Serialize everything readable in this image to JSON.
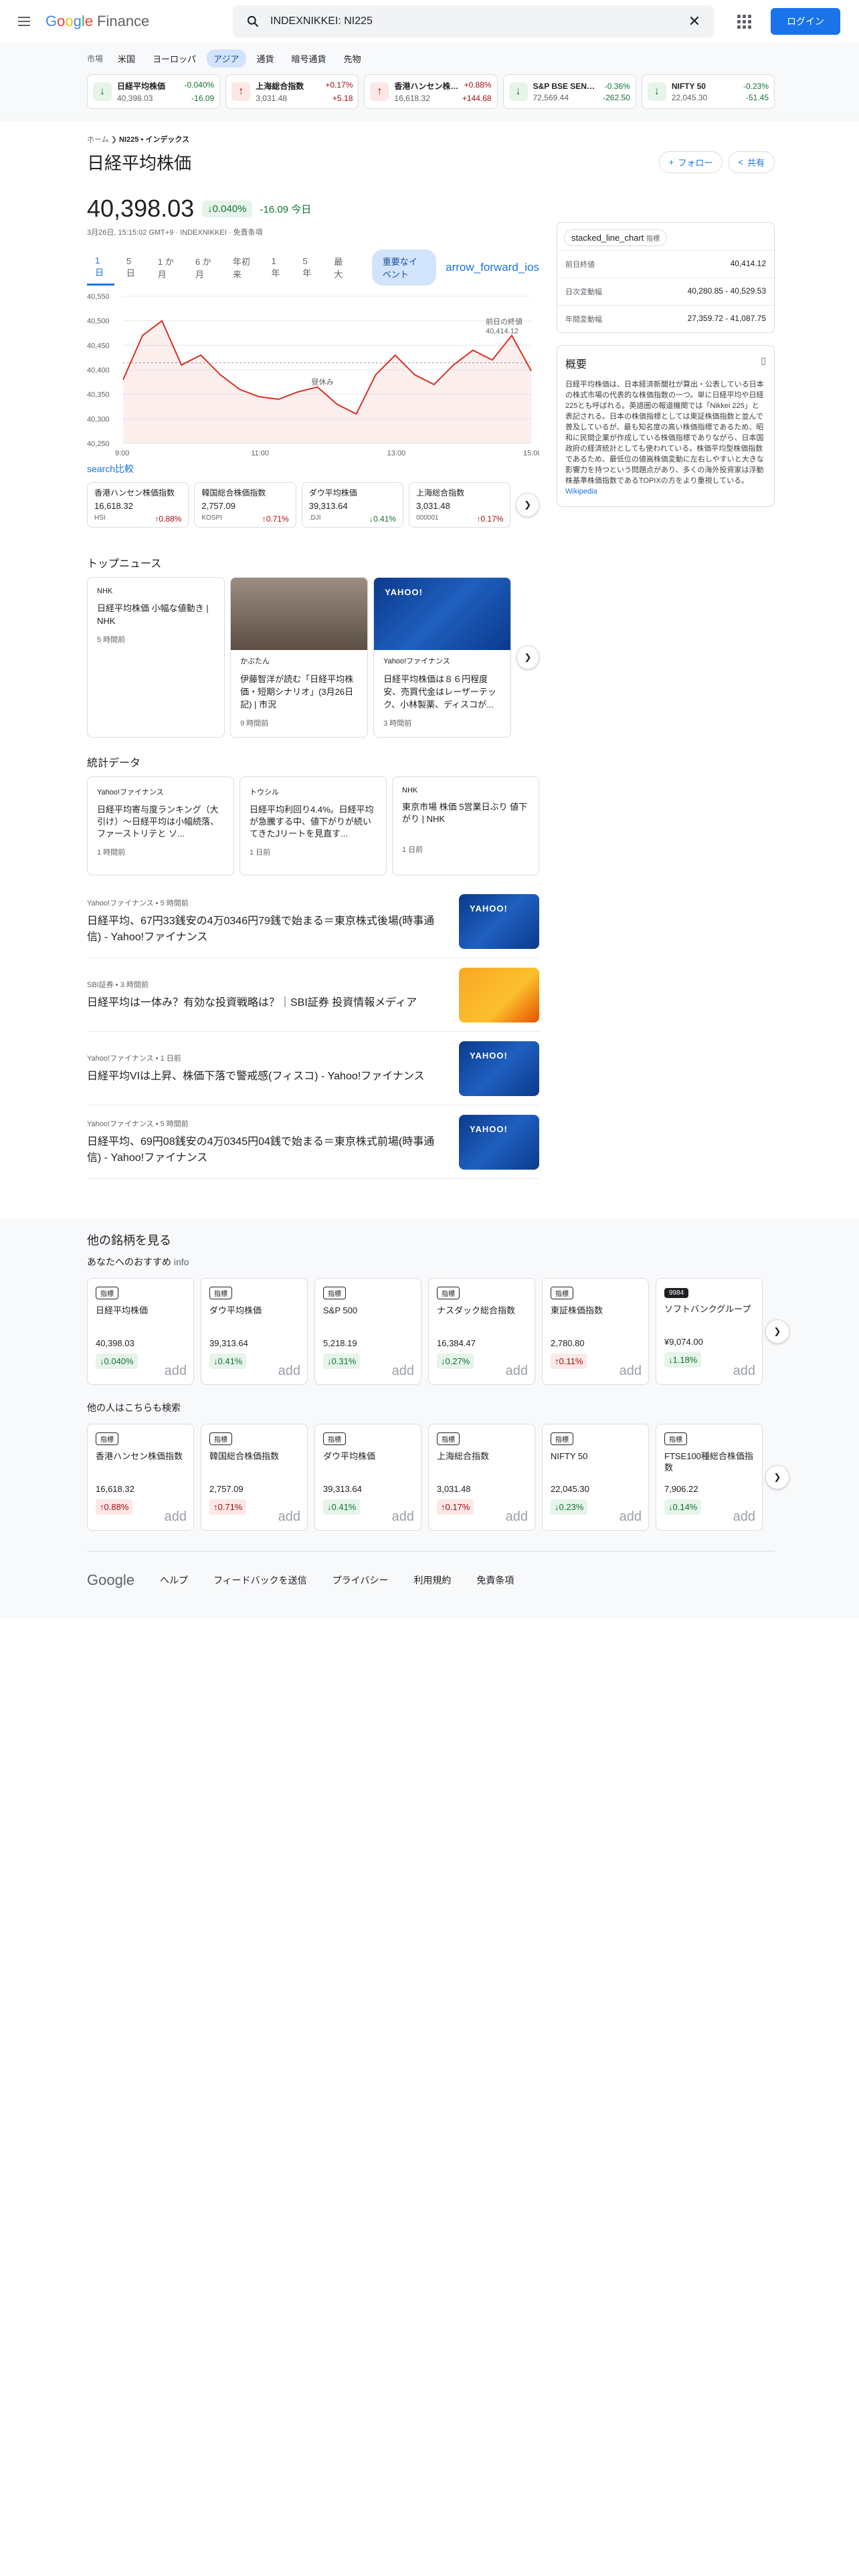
{
  "header": {
    "logo_google": [
      "G",
      "o",
      "o",
      "g",
      "l",
      "e"
    ],
    "logo_finance": "Finance",
    "search_value": "INDEXNIKKEI: NI225",
    "login_label": "ログイン"
  },
  "markets": {
    "label": "市場",
    "tabs": [
      "米国",
      "ヨーロッパ",
      "アジア",
      "通貨",
      "暗号通貨",
      "先物"
    ],
    "active_tab": "アジア",
    "tickers": [
      {
        "name": "日経平均株価",
        "pct": "-0.040%",
        "price": "40,398.03",
        "chg": "-16.09",
        "dir": "down"
      },
      {
        "name": "上海総合指数",
        "pct": "+0.17%",
        "price": "3,031.48",
        "chg": "+5.18",
        "dir": "up"
      },
      {
        "name": "香港ハンセン株価...",
        "pct": "+0.88%",
        "price": "16,618.32",
        "chg": "+144.68",
        "dir": "up"
      },
      {
        "name": "S&P BSE SENSEX",
        "pct": "-0.36%",
        "price": "72,569.44",
        "chg": "-262.50",
        "dir": "down"
      },
      {
        "name": "NIFTY 50",
        "pct": "-0.23%",
        "price": "22,045.30",
        "chg": "-51.45",
        "dir": "down"
      }
    ]
  },
  "quote": {
    "breadcrumb_home": "ホーム",
    "breadcrumb_symbol": "NI225 • インデックス",
    "title": "日経平均株価",
    "follow_label": "フォロー",
    "share_label": "共有",
    "price": "40,398.03",
    "change_pct": "↓0.040%",
    "change_text": "-16.09 今日",
    "meta": "3月26日, 15:15:02 GMT+9 · INDEXNIKKEI · 免責条項",
    "ranges": [
      "1 日",
      "5 日",
      "1 か月",
      "6 か月",
      "年初来",
      "1 年",
      "5 年",
      "最大"
    ],
    "active_range": "1 日",
    "events_label": "重要なイベント",
    "forward_icon_text": "arrow_forward_ios",
    "compare_label": "search比較"
  },
  "chart_data": {
    "type": "line",
    "x": [
      "9:00",
      "9:15",
      "9:30",
      "9:45",
      "10:00",
      "10:15",
      "10:30",
      "10:45",
      "11:00",
      "11:15",
      "11:30",
      "12:30",
      "12:45",
      "13:00",
      "13:15",
      "13:30",
      "13:45",
      "14:00",
      "14:15",
      "14:30",
      "14:45",
      "15:00"
    ],
    "values": [
      40380,
      40470,
      40500,
      40410,
      40430,
      40390,
      40360,
      40345,
      40340,
      40355,
      40365,
      40330,
      40310,
      40390,
      40430,
      40390,
      40370,
      40410,
      40440,
      40420,
      40470,
      40398
    ],
    "previous_close": 40414.12,
    "ylim": [
      40250,
      40550
    ],
    "yticks": [
      "40,550",
      "40,500",
      "40,450",
      "40,400",
      "40,350",
      "40,300",
      "40,250"
    ],
    "xticks": [
      "9:00",
      "11:00",
      "13:00",
      "15:00"
    ],
    "break_label": "昼休み",
    "prev_close_label": "前日の終値",
    "prev_close_value": "40,414.12",
    "line_color": "#d93025"
  },
  "compare": [
    {
      "name": "香港ハンセン株価指数",
      "price": "16,618.32",
      "code": "HSI",
      "chg": "↑0.88%",
      "dir": "up"
    },
    {
      "name": "韓国総合株価指数",
      "price": "2,757.09",
      "code": "KOSPI",
      "chg": "↑0.71%",
      "dir": "up"
    },
    {
      "name": "ダウ平均株価",
      "price": "39,313.64",
      "code": ".DJI",
      "chg": "↓0.41%",
      "dir": "down"
    },
    {
      "name": "上海総合指数",
      "price": "3,031.48",
      "code": "000001",
      "chg": "↑0.17%",
      "dir": "up"
    }
  ],
  "stats": {
    "chip_label": "stacked_line_chart",
    "chip_sub": "指標",
    "rows": [
      {
        "k": "前日終値",
        "v": "40,414.12"
      },
      {
        "k": "日次変動幅",
        "v": "40,280.85 - 40,529.53"
      },
      {
        "k": "年間変動幅",
        "v": "27,359.72 - 41,087.75"
      }
    ]
  },
  "about": {
    "title": "概要",
    "text": "日経平均株価は、日本経済新聞社が算出・公表している日本の株式市場の代表的な株価指数の一つ。単に日経平均や日経225とも呼ばれる。英語圏の報道機関では「Nikkei 225」と表記される。日本の株価指標としては東証株価指数と並んで普及しているが、最も知名度の高い株価指標であるため、昭和に民間企業が作成している株価指標でありながら、日本国政府の経済統計としても使われている。株価平均型株価指数であるため、最低位の値嵩株価変動に左右しやすいと大きな影響力を持つという問題点があり、多くの海外投資家は浮動株基準株価指数であるTOPIXの方をより重視している。",
    "link": "Wikipedia"
  },
  "top_news": {
    "title": "トップニュース",
    "cards": [
      {
        "src": "NHK",
        "headline": "日経平均株価 小幅な値動き | NHK",
        "time": "5 時間前",
        "img": "none"
      },
      {
        "src": "かぶたん",
        "headline": "伊藤智洋が読む「日経平均株価・短期シナリオ」(3月26日記) | 市況",
        "time": "9 時間前",
        "img": "person"
      },
      {
        "src": "Yahoo!ファイナンス",
        "headline": "日経平均株価は８６円程度安、売買代金はレーザーテック、小林製薬、ディスコが...",
        "time": "3 時間前",
        "img": "yahoo"
      }
    ]
  },
  "stat_news": {
    "title": "統計データ",
    "cards": [
      {
        "src": "Yahoo!ファイナンス",
        "headline": "日経平均寄与度ランキング（大引け）～日経平均は小幅続落、ファーストリテと ソ...",
        "time": "1 時間前"
      },
      {
        "src": "トウシル",
        "headline": "日経平均利回り4.4%。日経平均が急騰する中、値下がりが続いてきたJリートを見直す...",
        "time": "1 日前"
      },
      {
        "src": "NHK",
        "headline": "東京市場 株価 5営業日ぶり 値下がり | NHK",
        "time": "1 日前"
      }
    ]
  },
  "news_list": [
    {
      "src": "Yahoo!ファイナンス",
      "time": "5 時間前",
      "headline": "日経平均、67円33銭安の4万0346円79銭で始まる＝東京株式後場(時事通信) - Yahoo!ファイナンス",
      "img": "yahoo"
    },
    {
      "src": "SBI証券",
      "time": "3 時間前",
      "headline": "日経平均は一体み？有効な投資戦略は？｜SBI証券 投資情報メディア",
      "img": "sbi"
    },
    {
      "src": "Yahoo!ファイナンス",
      "time": "1 日前",
      "headline": "日経平均VIは上昇、株価下落で警戒感(フィスコ) - Yahoo!ファイナンス",
      "img": "yahoo"
    },
    {
      "src": "Yahoo!ファイナンス",
      "time": "5 時間前",
      "headline": "日経平均、69円08銭安の4万0345円04銭で始まる＝東京株式前場(時事通信) - Yahoo!ファイナンス",
      "img": "yahoo"
    }
  ],
  "other": {
    "title": "他の銘柄を見る",
    "rec_title": "あなたへのおすすめ",
    "rec_info": "info",
    "rec": [
      {
        "tag": "指標",
        "name": "日経平均株価",
        "price": "40,398.03",
        "chg": "↓0.040%",
        "dir": "down"
      },
      {
        "tag": "指標",
        "name": "ダウ平均株価",
        "price": "39,313.64",
        "chg": "↓0.41%",
        "dir": "down"
      },
      {
        "tag": "指標",
        "name": "S&P 500",
        "price": "5,218.19",
        "chg": "↓0.31%",
        "dir": "down"
      },
      {
        "tag": "指標",
        "name": "ナスダック総合指数",
        "price": "16,384.47",
        "chg": "↓0.27%",
        "dir": "down"
      },
      {
        "tag": "指標",
        "name": "東証株価指数",
        "price": "2,780.80",
        "chg": "↑0.11%",
        "dir": "up"
      },
      {
        "tag": "9984",
        "name": "ソフトバンクグループ",
        "price": "¥9,074.00",
        "chg": "↓1.18%",
        "dir": "down"
      }
    ],
    "also_title": "他の人はこちらも検索",
    "also": [
      {
        "tag": "指標",
        "name": "香港ハンセン株価指数",
        "price": "16,618.32",
        "chg": "↑0.88%",
        "dir": "up"
      },
      {
        "tag": "指標",
        "name": "韓国総合株価指数",
        "price": "2,757.09",
        "chg": "↑0.71%",
        "dir": "up"
      },
      {
        "tag": "指標",
        "name": "ダウ平均株価",
        "price": "39,313.64",
        "chg": "↓0.41%",
        "dir": "down"
      },
      {
        "tag": "指標",
        "name": "上海総合指数",
        "price": "3,031.48",
        "chg": "↑0.17%",
        "dir": "up"
      },
      {
        "tag": "指標",
        "name": "NIFTY 50",
        "price": "22,045.30",
        "chg": "↓0.23%",
        "dir": "down"
      },
      {
        "tag": "指標",
        "name": "FTSE100種総合株価指数",
        "price": "7,906.22",
        "chg": "↓0.14%",
        "dir": "down"
      }
    ],
    "add_label": "add"
  },
  "footer": {
    "logo": "Google",
    "links": [
      "ヘルプ",
      "フィードバックを送信",
      "プライバシー",
      "利用規約",
      "免責条項"
    ]
  }
}
